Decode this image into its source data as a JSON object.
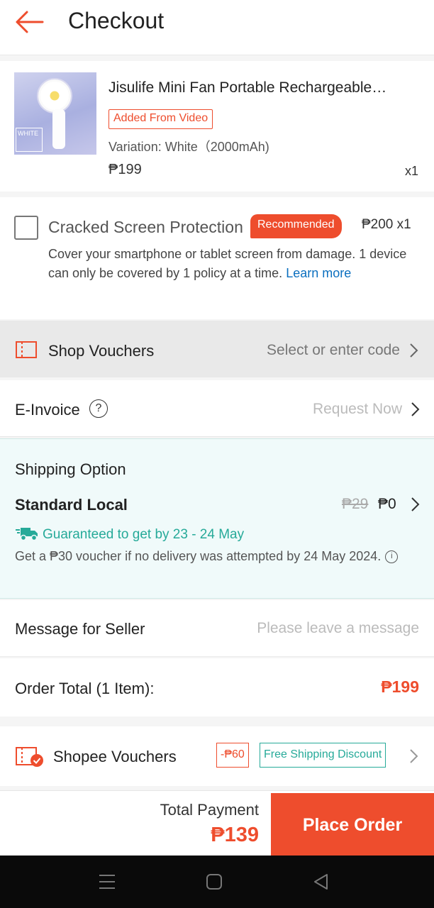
{
  "header": {
    "title": "Checkout"
  },
  "product": {
    "name": "Jisulife Mini Fan Portable Rechargeable…",
    "badge": "Added From Video",
    "variation": "Variation: White（2000mAh)",
    "price": "₱199",
    "quantity": "x1",
    "thumbnail_text": "WHITE"
  },
  "protection": {
    "title": "Cracked Screen Protection",
    "badge": "Recommended",
    "price_qty": "₱200  x1",
    "description": "Cover your smartphone or tablet screen from damage. 1 device can only be covered by 1 policy at a time. ",
    "link": "Learn more"
  },
  "shop_vouchers": {
    "label": "Shop Vouchers",
    "action": "Select or enter code"
  },
  "einvoice": {
    "label": "E-Invoice",
    "help_icon": "?",
    "action": "Request Now"
  },
  "shipping": {
    "title": "Shipping Option",
    "method": "Standard Local",
    "original_price": "₱29",
    "price": "₱0",
    "guarantee": "Guaranteed to get by 23 - 24 May",
    "note": "Get a ₱30 voucher if no delivery was attempted by 24 May 2024.",
    "info_icon": "i"
  },
  "message": {
    "label": "Message for Seller",
    "placeholder": "Please leave a message"
  },
  "order_total": {
    "label": "Order Total (1 Item):",
    "amount": "₱199"
  },
  "shopee_vouchers": {
    "label": "Shopee Vouchers",
    "tags": [
      "-₱60",
      "Free Shipping Discount"
    ]
  },
  "footer": {
    "total_label": "Total Payment",
    "total_amount": "₱139",
    "button": "Place Order"
  },
  "colors": {
    "accent": "#ee4d2d",
    "teal": "#26aa99",
    "link": "#0b6fbf"
  },
  "icons": [
    "back-arrow-icon",
    "voucher-ticket-icon",
    "chevron-right-icon",
    "question-icon",
    "truck-icon",
    "info-icon",
    "menu-icon",
    "home-icon",
    "back-triangle-icon"
  ]
}
